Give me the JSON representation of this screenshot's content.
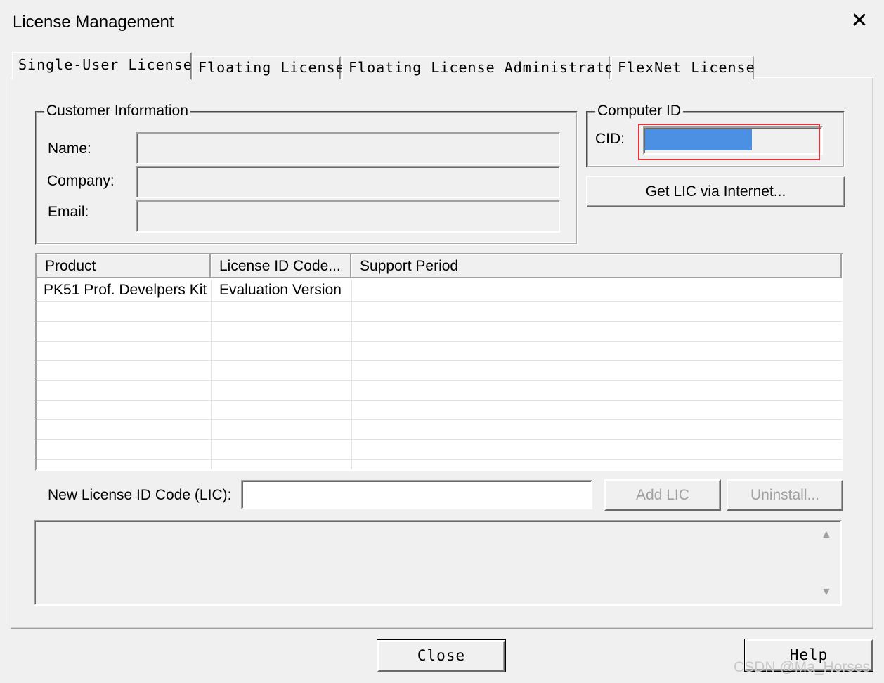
{
  "window": {
    "title": "License Management",
    "close_glyph": "✕"
  },
  "tabs": [
    {
      "label": "Single-User License",
      "active": true
    },
    {
      "label": "Floating License",
      "active": false
    },
    {
      "label": "Floating License Administrator",
      "active": false
    },
    {
      "label": "FlexNet License",
      "active": false
    }
  ],
  "customer_info": {
    "legend": "Customer Information",
    "name_label": "Name:",
    "company_label": "Company:",
    "email_label": "Email:"
  },
  "computer_id": {
    "legend": "Computer ID",
    "cid_label": "CID:",
    "get_lic_button": "Get LIC via Internet..."
  },
  "table": {
    "columns": [
      "Product",
      "License ID Code...",
      "Support Period"
    ],
    "rows": [
      [
        "PK51 Prof. Develpers Kit",
        "Evaluation Version",
        ""
      ]
    ]
  },
  "new_lic": {
    "label": "New License ID Code (LIC):",
    "value": "",
    "add_button": "Add LIC",
    "uninstall_button": "Uninstall..."
  },
  "footer": {
    "close_button": "Close",
    "help_button": "Help",
    "watermark": "CSDN @Ma_Horses"
  },
  "colors": {
    "window_bg": "#f0f0f0",
    "selection_blue": "#2f7fe0",
    "highlight_red": "#e0353d"
  }
}
